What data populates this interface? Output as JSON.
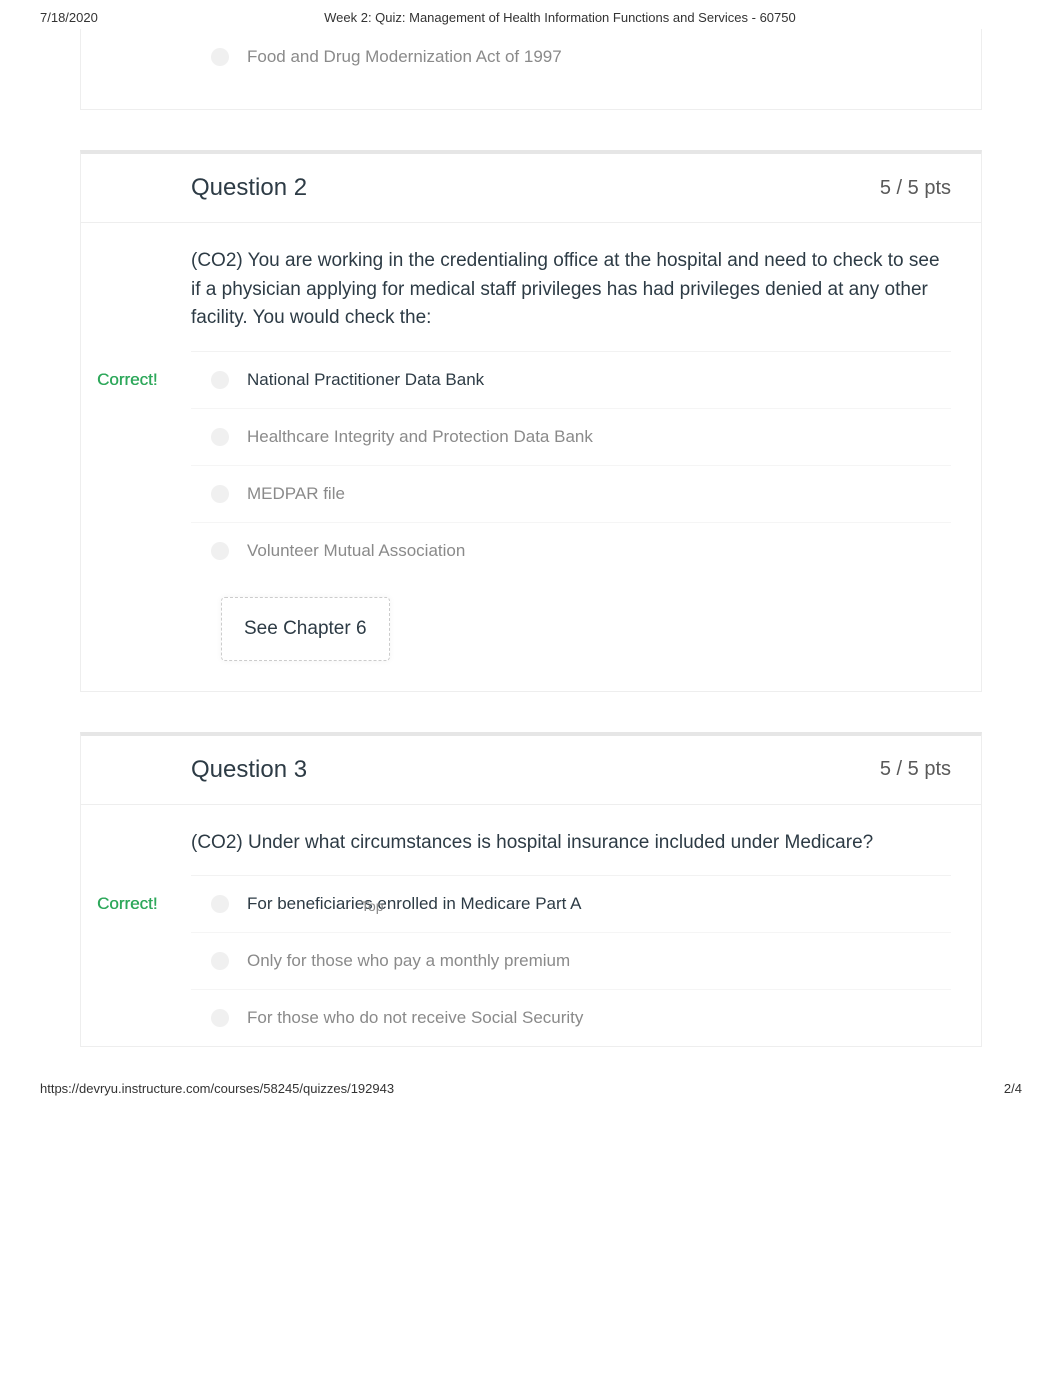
{
  "header": {
    "date": "7/18/2020",
    "title": "Week 2: Quiz: Management of Health Information Functions and Services - 60750"
  },
  "q1_partial": {
    "answers": [
      {
        "label": "Food and Drug Modernization Act of 1997",
        "correct": false
      }
    ]
  },
  "q2": {
    "title": "Question 2",
    "points": "5 / 5 pts",
    "text": "(CO2) You are working in the credentialing office at the hospital and need to check to see if a physician applying for medical staff privileges has had privileges denied at any other facility. You would check the:",
    "correct_label": "Correct!",
    "answers": [
      {
        "label": "National Practitioner Data Bank",
        "correct": true
      },
      {
        "label": "Healthcare Integrity and Protection Data Bank",
        "correct": false
      },
      {
        "label": "MEDPAR file",
        "correct": false
      },
      {
        "label": "Volunteer Mutual Association",
        "correct": false
      }
    ],
    "feedback": "See Chapter 6"
  },
  "q3": {
    "title": "Question 3",
    "points": "5 / 5 pts",
    "text": "(CO2) Under what circumstances is hospital insurance included under Medicare?",
    "correct_label": "Correct!",
    "answers": [
      {
        "label": "For beneficiaries enrolled in Medicare Part A",
        "correct": true
      },
      {
        "label": "Only for those who pay a monthly premium",
        "correct": false
      },
      {
        "label": "For those who do not receive Social Security",
        "correct": false
      }
    ],
    "top_link": "Top"
  },
  "footer": {
    "url": "https://devryu.instructure.com/courses/58245/quizzes/192943",
    "page": "2/4"
  }
}
